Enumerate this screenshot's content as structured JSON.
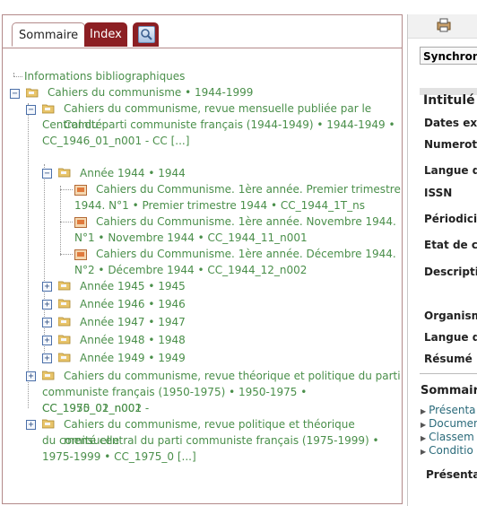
{
  "tabs": {
    "sommaire": "Sommaire",
    "index": "Index"
  },
  "tree": {
    "root": "Informations bibliographiques",
    "n1": "Cahiers du communisme • 1944-1999",
    "n2a": "Cahiers du communisme, revue mensuelle publiée par le Comité",
    "n2b": "Central du parti communiste français (1944-1949) • 1944-1949 •",
    "n2c": "CC_1946_01_n001 - CC [...]",
    "y1944": "Année 1944 • 1944",
    "d1a": "Cahiers du Communisme. 1ère année. Premier trimestre",
    "d1b": "1944. N°1 • Premier trimestre 1944 • CC_1944_1T_ns",
    "d2a": "Cahiers du Communisme. 1ère année. Novembre 1944.",
    "d2b": "N°1 • Novembre 1944 • CC_1944_11_n001",
    "d3a": "Cahiers du Communisme. 1ère année. Décembre 1944.",
    "d3b": "N°2 • Décembre 1944 • CC_1944_12_n002",
    "y1945": "Année 1945 • 1945",
    "y1946": "Année 1946 • 1946",
    "y1947": "Année 1947 • 1947",
    "y1948": "Année 1948 • 1948",
    "y1949": "Année 1949 • 1949",
    "n3a": "Cahiers du communisme, revue théorique et politique du parti",
    "n3b": "communiste français (1950-1975) • 1950-1975 • CC_1950_01_n001 -",
    "n3c": "CC_1975_02_n002",
    "n4a": "Cahiers du communisme, revue politique et théorique mensuelle",
    "n4b": "du comité central du parti communiste français (1975-1999) •",
    "n4c": "1975-1999 • CC_1975_0 [...]"
  },
  "right": {
    "sync": "Synchroni",
    "intitule": "Intitulé",
    "fields": [
      "Dates ext",
      "Numerota",
      "Langue d",
      "ISSN",
      "Périodicit",
      "Etat de co",
      "Descriptio",
      "Organism",
      "Langue d",
      "Résumé"
    ],
    "sommaire": "Sommair",
    "links": [
      "Présenta",
      "Documen",
      "Classem",
      "Conditio"
    ],
    "presentation": "Présentat"
  },
  "colors": {
    "tab_accent": "#8c1f23",
    "tree_text": "#4a8f4a",
    "border": "#b38a8a"
  }
}
